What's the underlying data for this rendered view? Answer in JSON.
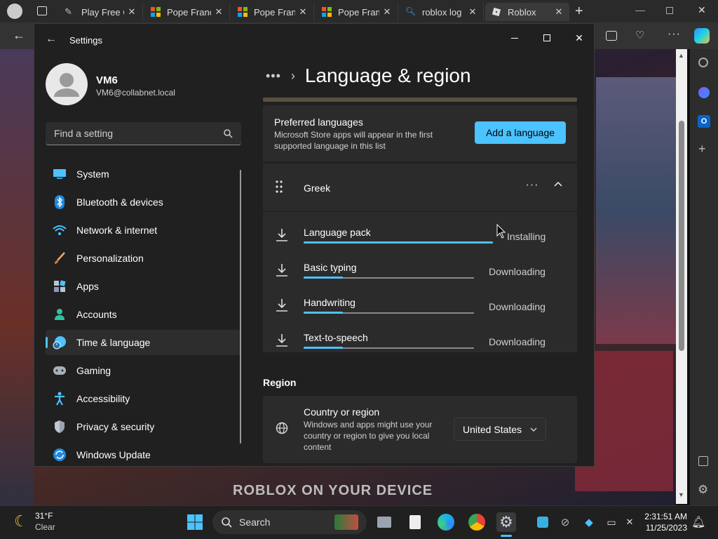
{
  "browser": {
    "tabs": [
      {
        "label": "Play Free C"
      },
      {
        "label": "Pope Franc"
      },
      {
        "label": "Pope Franc"
      },
      {
        "label": "Pope Franc"
      },
      {
        "label": "roblox log"
      },
      {
        "label": "Roblox"
      }
    ]
  },
  "background": {
    "banner_text": "ROBLOX ON YOUR DEVICE"
  },
  "settings": {
    "window_title": "Settings",
    "profile": {
      "name": "VM6",
      "email": "VM6@collabnet.local"
    },
    "search": {
      "placeholder": "Find a setting"
    },
    "nav": [
      {
        "label": "System",
        "icon": "monitor-icon"
      },
      {
        "label": "Bluetooth & devices",
        "icon": "bluetooth-icon"
      },
      {
        "label": "Network & internet",
        "icon": "wifi-icon"
      },
      {
        "label": "Personalization",
        "icon": "brush-icon"
      },
      {
        "label": "Apps",
        "icon": "apps-icon"
      },
      {
        "label": "Accounts",
        "icon": "person-icon"
      },
      {
        "label": "Time & language",
        "icon": "clock-globe-icon",
        "selected": true
      },
      {
        "label": "Gaming",
        "icon": "gamepad-icon"
      },
      {
        "label": "Accessibility",
        "icon": "accessibility-icon"
      },
      {
        "label": "Privacy & security",
        "icon": "shield-icon"
      },
      {
        "label": "Windows Update",
        "icon": "update-icon"
      }
    ],
    "breadcrumb": {
      "ellipsis": "•••",
      "title": "Language & region"
    },
    "preferred": {
      "title": "Preferred languages",
      "description": "Microsoft Store apps will appear in the first supported language in this list",
      "add_button": "Add a language"
    },
    "language": {
      "name": "Greek"
    },
    "features": [
      {
        "name": "Language pack",
        "status": "Installing",
        "progress": 1.0
      },
      {
        "name": "Basic typing",
        "status": "Downloading",
        "progress": 0.23
      },
      {
        "name": "Handwriting",
        "status": "Downloading",
        "progress": 0.23
      },
      {
        "name": "Text-to-speech",
        "status": "Downloading",
        "progress": 0.23
      }
    ],
    "region": {
      "heading": "Region",
      "country_title": "Country or region",
      "country_desc": "Windows and apps might use your country or region to give you local content",
      "country_value": "United States"
    }
  },
  "taskbar": {
    "weather_temp": "31°F",
    "weather_cond": "Clear",
    "search_label": "Search",
    "time": "2:31:51 AM",
    "date": "11/25/2023"
  },
  "colors": {
    "accent": "#4cc2ff",
    "window_bg": "#202020",
    "card_bg": "#2b2b2b"
  }
}
